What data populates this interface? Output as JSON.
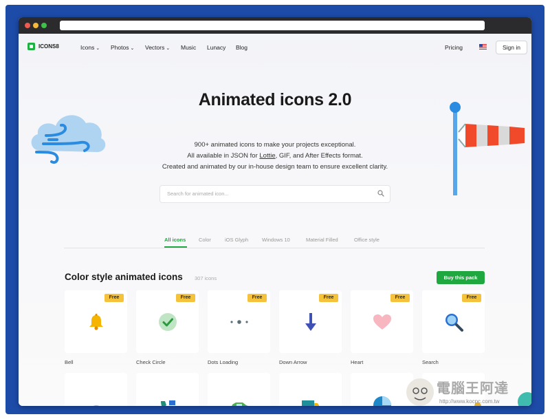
{
  "nav": {
    "brand": "ICONS8",
    "items": [
      "Icons",
      "Photos",
      "Vectors",
      "Music",
      "Lunacy",
      "Blog"
    ],
    "pricing": "Pricing",
    "sign_in": "Sign in"
  },
  "hero": {
    "title": "Animated icons 2.0",
    "line1": "900+ animated icons to make your projects exceptional.",
    "line2_pre": "All available in JSON for ",
    "line2_link": "Lottie",
    "line2_post": ", GIF, and After Effects format.",
    "line3": "Created and animated by our in-house design team to ensure excellent clarity.",
    "search_placeholder": "Search for animated icon..."
  },
  "tabs": [
    "All icons",
    "Color",
    "iOS Glyph",
    "Windows 10",
    "Material Filled",
    "Office style"
  ],
  "section": {
    "title": "Color style animated icons",
    "count": "307 icons",
    "buy_button": "Buy this pack"
  },
  "cards": [
    {
      "label": "Bell",
      "badge": "Free",
      "icon": "bell-icon"
    },
    {
      "label": "Check Circle",
      "badge": "Free",
      "icon": "check-circle-icon"
    },
    {
      "label": "Dots Loading",
      "badge": "Free",
      "icon": "dots-loading-icon"
    },
    {
      "label": "Down Arrow",
      "badge": "Free",
      "icon": "down-arrow-icon"
    },
    {
      "label": "Heart",
      "badge": "Free",
      "icon": "heart-icon"
    },
    {
      "label": "Search",
      "badge": "Free",
      "icon": "search-icon"
    }
  ],
  "watermark": {
    "title": "電腦王阿達",
    "url": "http://www.kocpc.com.tw"
  },
  "colors": {
    "accent": "#1fa83f",
    "badge": "#f5c33b",
    "frame": "#1d4ba8"
  }
}
